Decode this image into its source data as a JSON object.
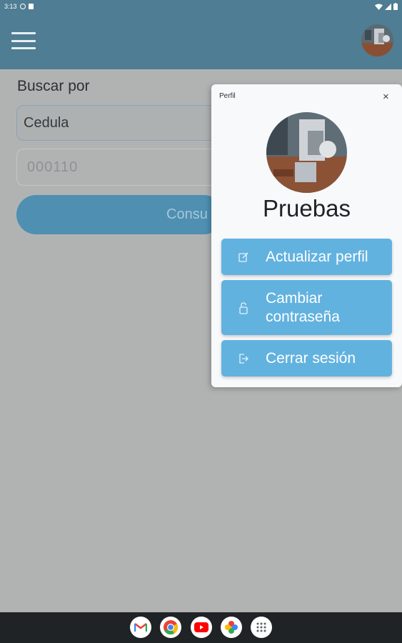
{
  "status_bar": {
    "time": "3:13"
  },
  "search": {
    "label": "Buscar por",
    "select_value": "Cedula",
    "input_value": "000110",
    "consult_button_label": "Consu"
  },
  "profile_panel": {
    "title": "Perfil",
    "close_symbol": "×",
    "user_name": "Pruebas",
    "buttons": [
      {
        "label": "Actualizar perfil",
        "icon": "edit-icon"
      },
      {
        "label": "Cambiar contraseña",
        "icon": "lock-icon"
      },
      {
        "label": "Cerrar sesión",
        "icon": "logout-icon"
      }
    ]
  },
  "dock": {
    "apps": [
      "gmail-icon",
      "chrome-icon",
      "youtube-icon",
      "photos-icon",
      "app-drawer-icon"
    ]
  },
  "colors": {
    "app_bar": "#4f7d93",
    "menu_button": "#62b2df",
    "scrim_background": "#b1b3b3",
    "nav_bar": "#1f2326"
  }
}
